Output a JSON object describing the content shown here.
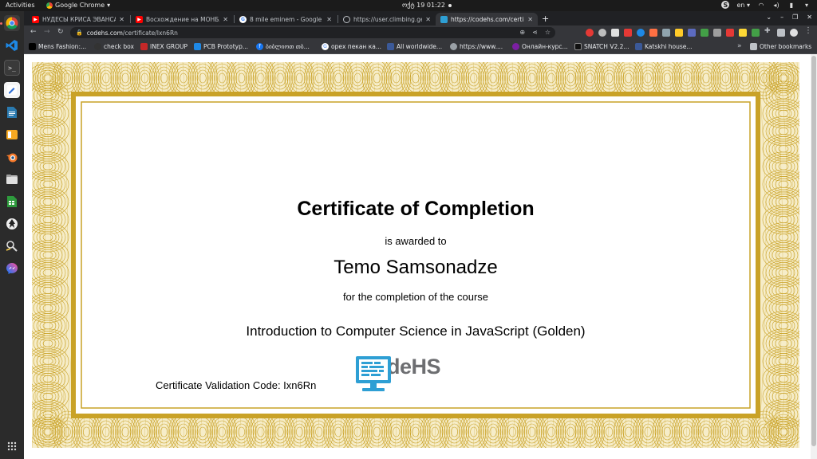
{
  "topbar": {
    "activities": "Activities",
    "app_name": "Google Chrome",
    "clock": "ოქტ 19  01:22",
    "lang": "en"
  },
  "browser": {
    "tabs": [
      {
        "title": "НУДЕСЫ КРИСА ЭВАНСА",
        "icon": "youtube-icon",
        "color": "#ff0000"
      },
      {
        "title": "Восхождение на МОНБЛАН",
        "icon": "youtube-icon",
        "color": "#ff0000"
      },
      {
        "title": "8 mile eminem - Google Se",
        "icon": "google-icon",
        "color": "#4285f4"
      },
      {
        "title": "https://user.climbing.ge/",
        "icon": "globe-icon",
        "color": "#9aa0a6"
      },
      {
        "title": "https://codehs.com/certi",
        "icon": "codehs-icon",
        "color": "#2e9fd4"
      }
    ],
    "url_host": "codehs.com",
    "url_path": "/certificate/Ixn6Rn",
    "bookmarks": [
      {
        "label": "Mens Fashion:...",
        "color": "#000000"
      },
      {
        "label": "check box",
        "color": "#333333"
      },
      {
        "label": "INEX GROUP",
        "color": "#c62828"
      },
      {
        "label": "PCB Prototyp...",
        "color": "#1e88e5"
      },
      {
        "label": "ბიბლიოთ თბ...",
        "color": "#1877f2"
      },
      {
        "label": "орех пекан ка...",
        "color": "#4285f4"
      },
      {
        "label": "All worldwide...",
        "color": "#3b5998"
      },
      {
        "label": "https://www....",
        "color": "#9aa0a6"
      },
      {
        "label": "Онлайн-курс...",
        "color": "#7b1fa2"
      },
      {
        "label": "SNATCH V2.2...",
        "color": "#111111"
      },
      {
        "label": "Katskhi house...",
        "color": "#3b5998"
      }
    ],
    "other_bookmarks": "Other bookmarks"
  },
  "certificate": {
    "title": "Certificate of Completion",
    "awarded": "is awarded to",
    "name": "Temo Samsonadze",
    "for_text": "for the completion of the course",
    "course": "Introduction to Computer Science in JavaScript (Golden)",
    "validation": "Certificate Validation Code: Ixn6Rn",
    "brand": "CodeHS",
    "border_color": "#c9a227",
    "logo_color": "#2e9fd4"
  }
}
